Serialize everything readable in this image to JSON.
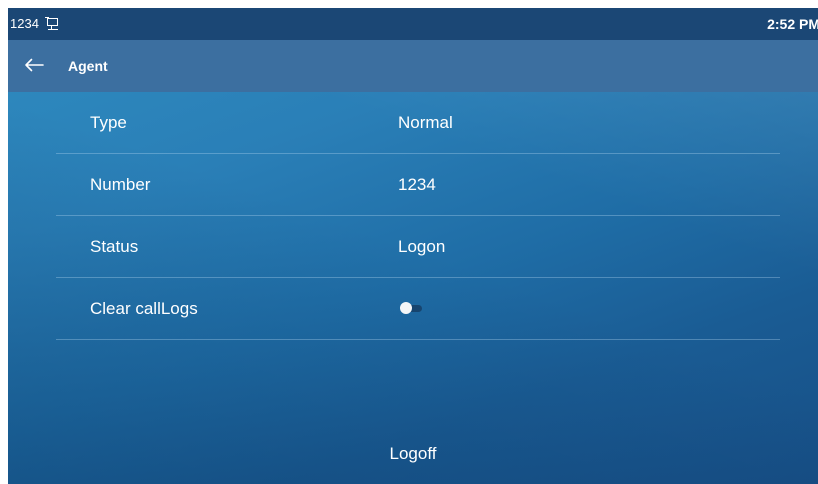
{
  "status_bar": {
    "number": "1234",
    "time": "2:52 PM",
    "icon": "desk-phone-icon"
  },
  "header": {
    "title": "Agent",
    "back_icon": "arrow-left-icon"
  },
  "rows": [
    {
      "label": "Type",
      "value": "Normal"
    },
    {
      "label": "Number",
      "value": "1234"
    },
    {
      "label": "Status",
      "value": "Logon"
    },
    {
      "label": "Clear callLogs",
      "toggle_on": false
    }
  ],
  "footer": {
    "logoff_label": "Logoff"
  },
  "colors": {
    "status_bar": "#1b4775",
    "title_bar": "#3c6fa0",
    "background": "#2a7fb7"
  }
}
